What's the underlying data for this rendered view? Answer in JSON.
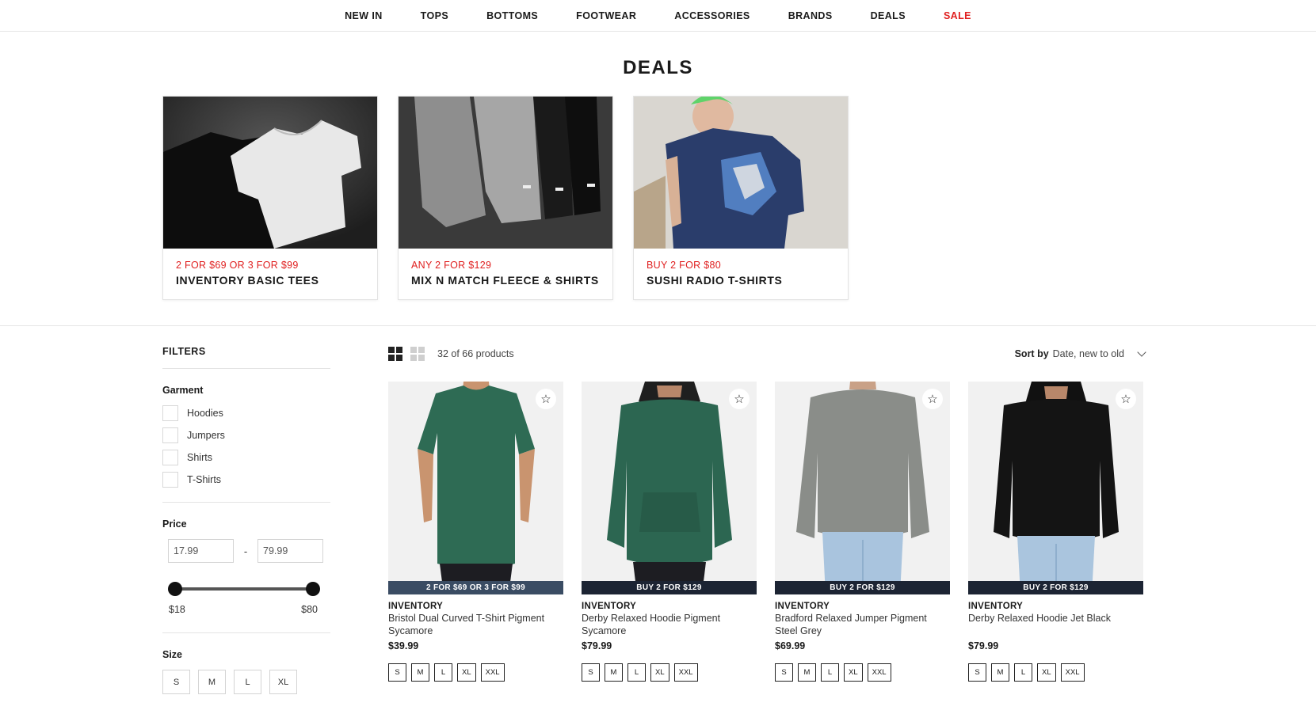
{
  "nav": {
    "items": [
      "NEW IN",
      "TOPS",
      "BOTTOMS",
      "FOOTWEAR",
      "ACCESSORIES",
      "BRANDS",
      "DEALS",
      "SALE"
    ]
  },
  "page": {
    "title": "DEALS"
  },
  "promos": [
    {
      "deal": "2 FOR $69 OR 3 FOR $99",
      "name": "INVENTORY BASIC TEES"
    },
    {
      "deal": "ANY 2 FOR $129",
      "name": "MIX N MATCH FLEECE & SHIRTS"
    },
    {
      "deal": "BUY 2 FOR $80",
      "name": "SUSHI RADIO T-SHIRTS"
    }
  ],
  "filters": {
    "title": "FILTERS",
    "garment": {
      "label": "Garment",
      "options": [
        "Hoodies",
        "Jumpers",
        "Shirts",
        "T-Shirts"
      ]
    },
    "price": {
      "label": "Price",
      "min_value": "17.99",
      "max_value": "79.99",
      "dash": "-",
      "min_label": "$18",
      "max_label": "$80"
    },
    "size": {
      "label": "Size",
      "options": [
        "S",
        "M",
        "L",
        "XL"
      ]
    }
  },
  "toolbar": {
    "count": "32 of 66 products",
    "sort_label": "Sort by",
    "sort_value": "Date, new to old"
  },
  "colors": {
    "sale": "#e02020",
    "ribbon_dark": "#1c2433",
    "ribbon_first": "#3a4c63"
  },
  "products": [
    {
      "ribbon": "2 FOR $69 OR 3 FOR $99",
      "brand": "INVENTORY",
      "name": "Bristol Dual Curved T-Shirt Pigment Sycamore",
      "price": "$39.99",
      "sizes": [
        "S",
        "M",
        "L",
        "XL",
        "XXL"
      ]
    },
    {
      "ribbon": "BUY 2 FOR $129",
      "brand": "INVENTORY",
      "name": "Derby Relaxed Hoodie Pigment Sycamore",
      "price": "$79.99",
      "sizes": [
        "S",
        "M",
        "L",
        "XL",
        "XXL"
      ]
    },
    {
      "ribbon": "BUY 2 FOR $129",
      "brand": "INVENTORY",
      "name": "Bradford Relaxed Jumper Pigment Steel Grey",
      "price": "$69.99",
      "sizes": [
        "S",
        "M",
        "L",
        "XL",
        "XXL"
      ]
    },
    {
      "ribbon": "BUY 2 FOR $129",
      "brand": "INVENTORY",
      "name": "Derby Relaxed Hoodie Jet Black",
      "price": "$79.99",
      "sizes": [
        "S",
        "M",
        "L",
        "XL",
        "XXL"
      ]
    }
  ]
}
